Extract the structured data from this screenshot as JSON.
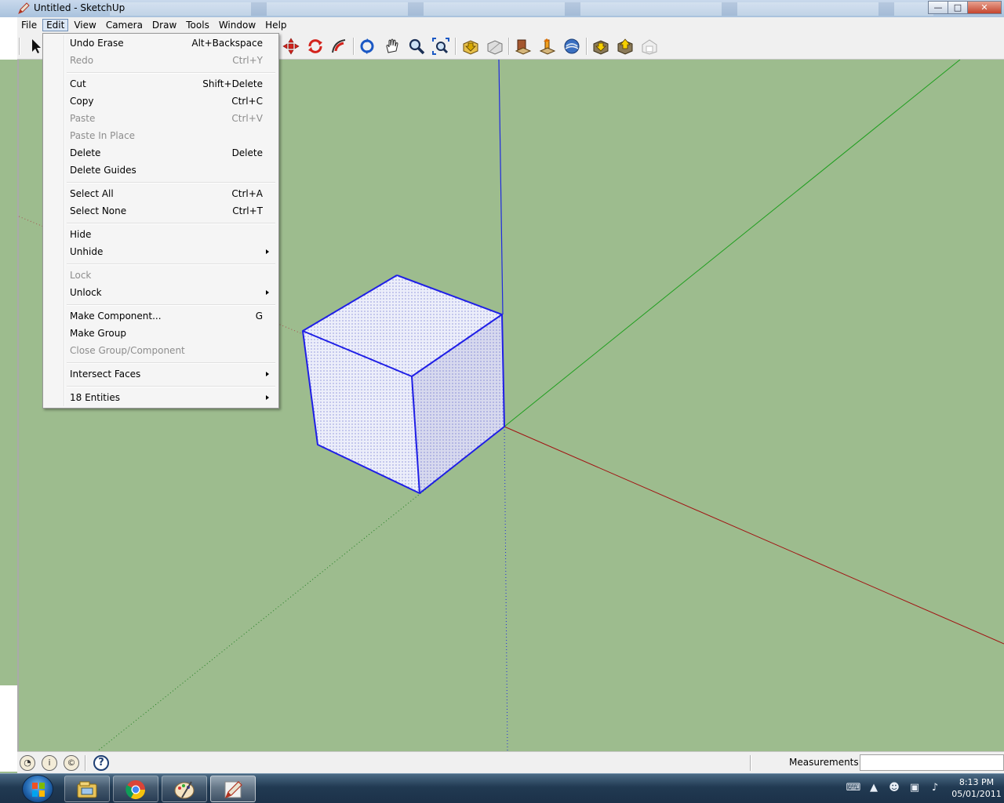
{
  "window": {
    "title": "Untitled - SketchUp",
    "app_icon": "sketchup-pencil-icon",
    "controls": {
      "minimize": "—",
      "maximize": "□",
      "close": "✕"
    }
  },
  "menubar": {
    "items": [
      {
        "label": "File"
      },
      {
        "label": "Edit",
        "active": true
      },
      {
        "label": "View"
      },
      {
        "label": "Camera"
      },
      {
        "label": "Draw"
      },
      {
        "label": "Tools"
      },
      {
        "label": "Window"
      },
      {
        "label": "Help"
      }
    ]
  },
  "edit_menu": {
    "items": [
      {
        "label": "Undo Erase",
        "shortcut": "Alt+Backspace",
        "enabled": true
      },
      {
        "label": "Redo",
        "shortcut": "Ctrl+Y",
        "enabled": false
      },
      {
        "label": "Cut",
        "shortcut": "Shift+Delete",
        "enabled": true
      },
      {
        "label": "Copy",
        "shortcut": "Ctrl+C",
        "enabled": true
      },
      {
        "label": "Paste",
        "shortcut": "Ctrl+V",
        "enabled": false
      },
      {
        "label": "Paste In Place",
        "shortcut": "",
        "enabled": false
      },
      {
        "label": "Delete",
        "shortcut": "Delete",
        "enabled": true
      },
      {
        "label": "Delete Guides",
        "shortcut": "",
        "enabled": true
      },
      {
        "label": "Select All",
        "shortcut": "Ctrl+A",
        "enabled": true
      },
      {
        "label": "Select None",
        "shortcut": "Ctrl+T",
        "enabled": true
      },
      {
        "label": "Hide",
        "shortcut": "",
        "enabled": true
      },
      {
        "label": "Unhide",
        "shortcut": "",
        "enabled": true,
        "submenu": true
      },
      {
        "label": "Lock",
        "shortcut": "",
        "enabled": false
      },
      {
        "label": "Unlock",
        "shortcut": "",
        "enabled": true,
        "submenu": true
      },
      {
        "label": "Make Component...",
        "shortcut": "G",
        "enabled": true
      },
      {
        "label": "Make Group",
        "shortcut": "",
        "enabled": true
      },
      {
        "label": "Close Group/Component",
        "shortcut": "",
        "enabled": false
      },
      {
        "label": "Intersect Faces",
        "shortcut": "",
        "enabled": true,
        "submenu": true
      },
      {
        "label": "18 Entities",
        "shortcut": "",
        "enabled": true,
        "submenu": true
      }
    ]
  },
  "toolbar": {
    "icons": [
      "select-arrow-icon",
      "move-icon",
      "rotate-icon",
      "follow-me-icon",
      "orbit-icon",
      "pan-hand-icon",
      "zoom-icon",
      "zoom-extents-icon",
      "get-models-icon",
      "share-model-icon",
      "get-components-icon",
      "share-component-icon",
      "google-earth-icon",
      "get-photo-texture-icon",
      "share-photo-icon",
      "preview-model-icon"
    ]
  },
  "viewport": {
    "colors": {
      "background": "#9dbc8e",
      "blue_axis": "#1f2ae0",
      "green_axis": "#1f9e1f",
      "red_axis": "#a11212",
      "selection": "#1f1fe6",
      "face": "#e9ecfa"
    }
  },
  "statusbar": {
    "icons": [
      "geo-location-icon",
      "credits-icon",
      "user-account-icon",
      "help-icon"
    ],
    "measurements_label": "Measurements",
    "measurements_value": ""
  },
  "taskbar": {
    "start": "windows-start-orb-icon",
    "apps": [
      "windows-explorer-icon",
      "chrome-icon",
      "paint-icon",
      "sketchup-icon"
    ],
    "tray_icons": [
      "keyboard-icon",
      "show-hidden-icons-icon",
      "chat-icon",
      "network-icon",
      "volume-icon"
    ],
    "time": "8:13 PM",
    "date": "05/01/2011"
  }
}
